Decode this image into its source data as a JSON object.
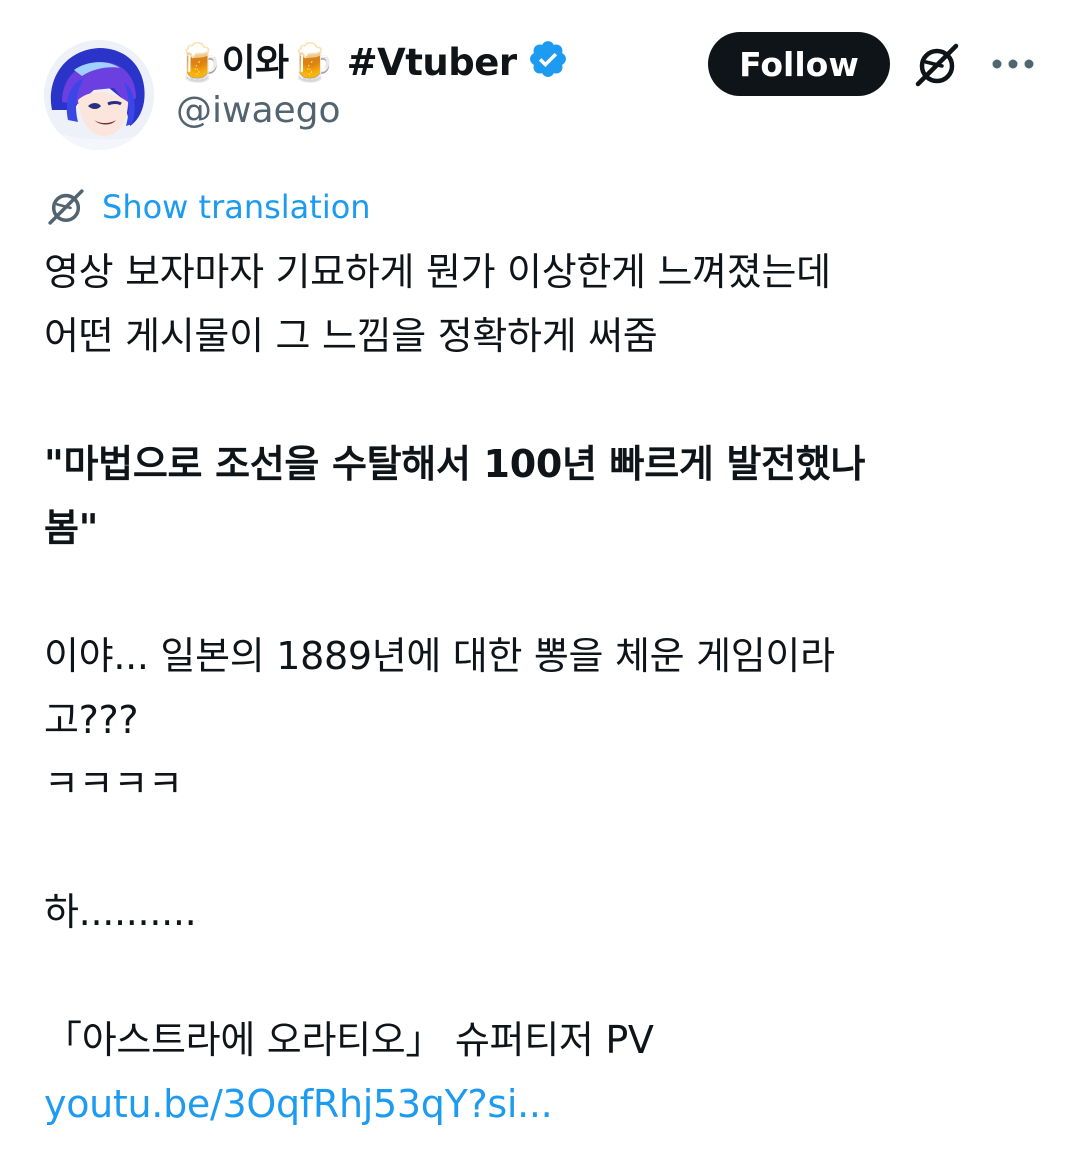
{
  "user": {
    "display_name": "🍺이와🍺 #Vtuber",
    "handle": "@iwaego",
    "verified": true,
    "follow_label": "Follow"
  },
  "translation": {
    "label": "Show translation"
  },
  "tweet": {
    "line1": "영상 보자마자 기묘하게 뭔가 이상한게 느껴졌는데",
    "line2": "어떤 게시물이 그 느낌을 정확하게 써줌",
    "quote_line1": "\"마법으로 조선을 수탈해서 100년 빠르게 발전했나",
    "quote_line2": "봄\"",
    "line3": "이야... 일본의 1889년에 대한 뽕을 체운 게임이라",
    "line4": "고???",
    "line5": "ㅋㅋㅋㅋ",
    "line6": "하..........",
    "line7": "「아스트라에 오라티오」 슈퍼티저 PV",
    "link": "youtu.be/3OqfRhj53qY?si..."
  },
  "colors": {
    "text": "#0f1419",
    "secondary": "#536471",
    "accent": "#1d9bf0",
    "follow_bg": "#0f1419"
  },
  "icons": {
    "verified": "verified-badge-icon",
    "grok": "grok-icon",
    "more": "more-dots-icon",
    "translate": "grok-translate-icon"
  }
}
